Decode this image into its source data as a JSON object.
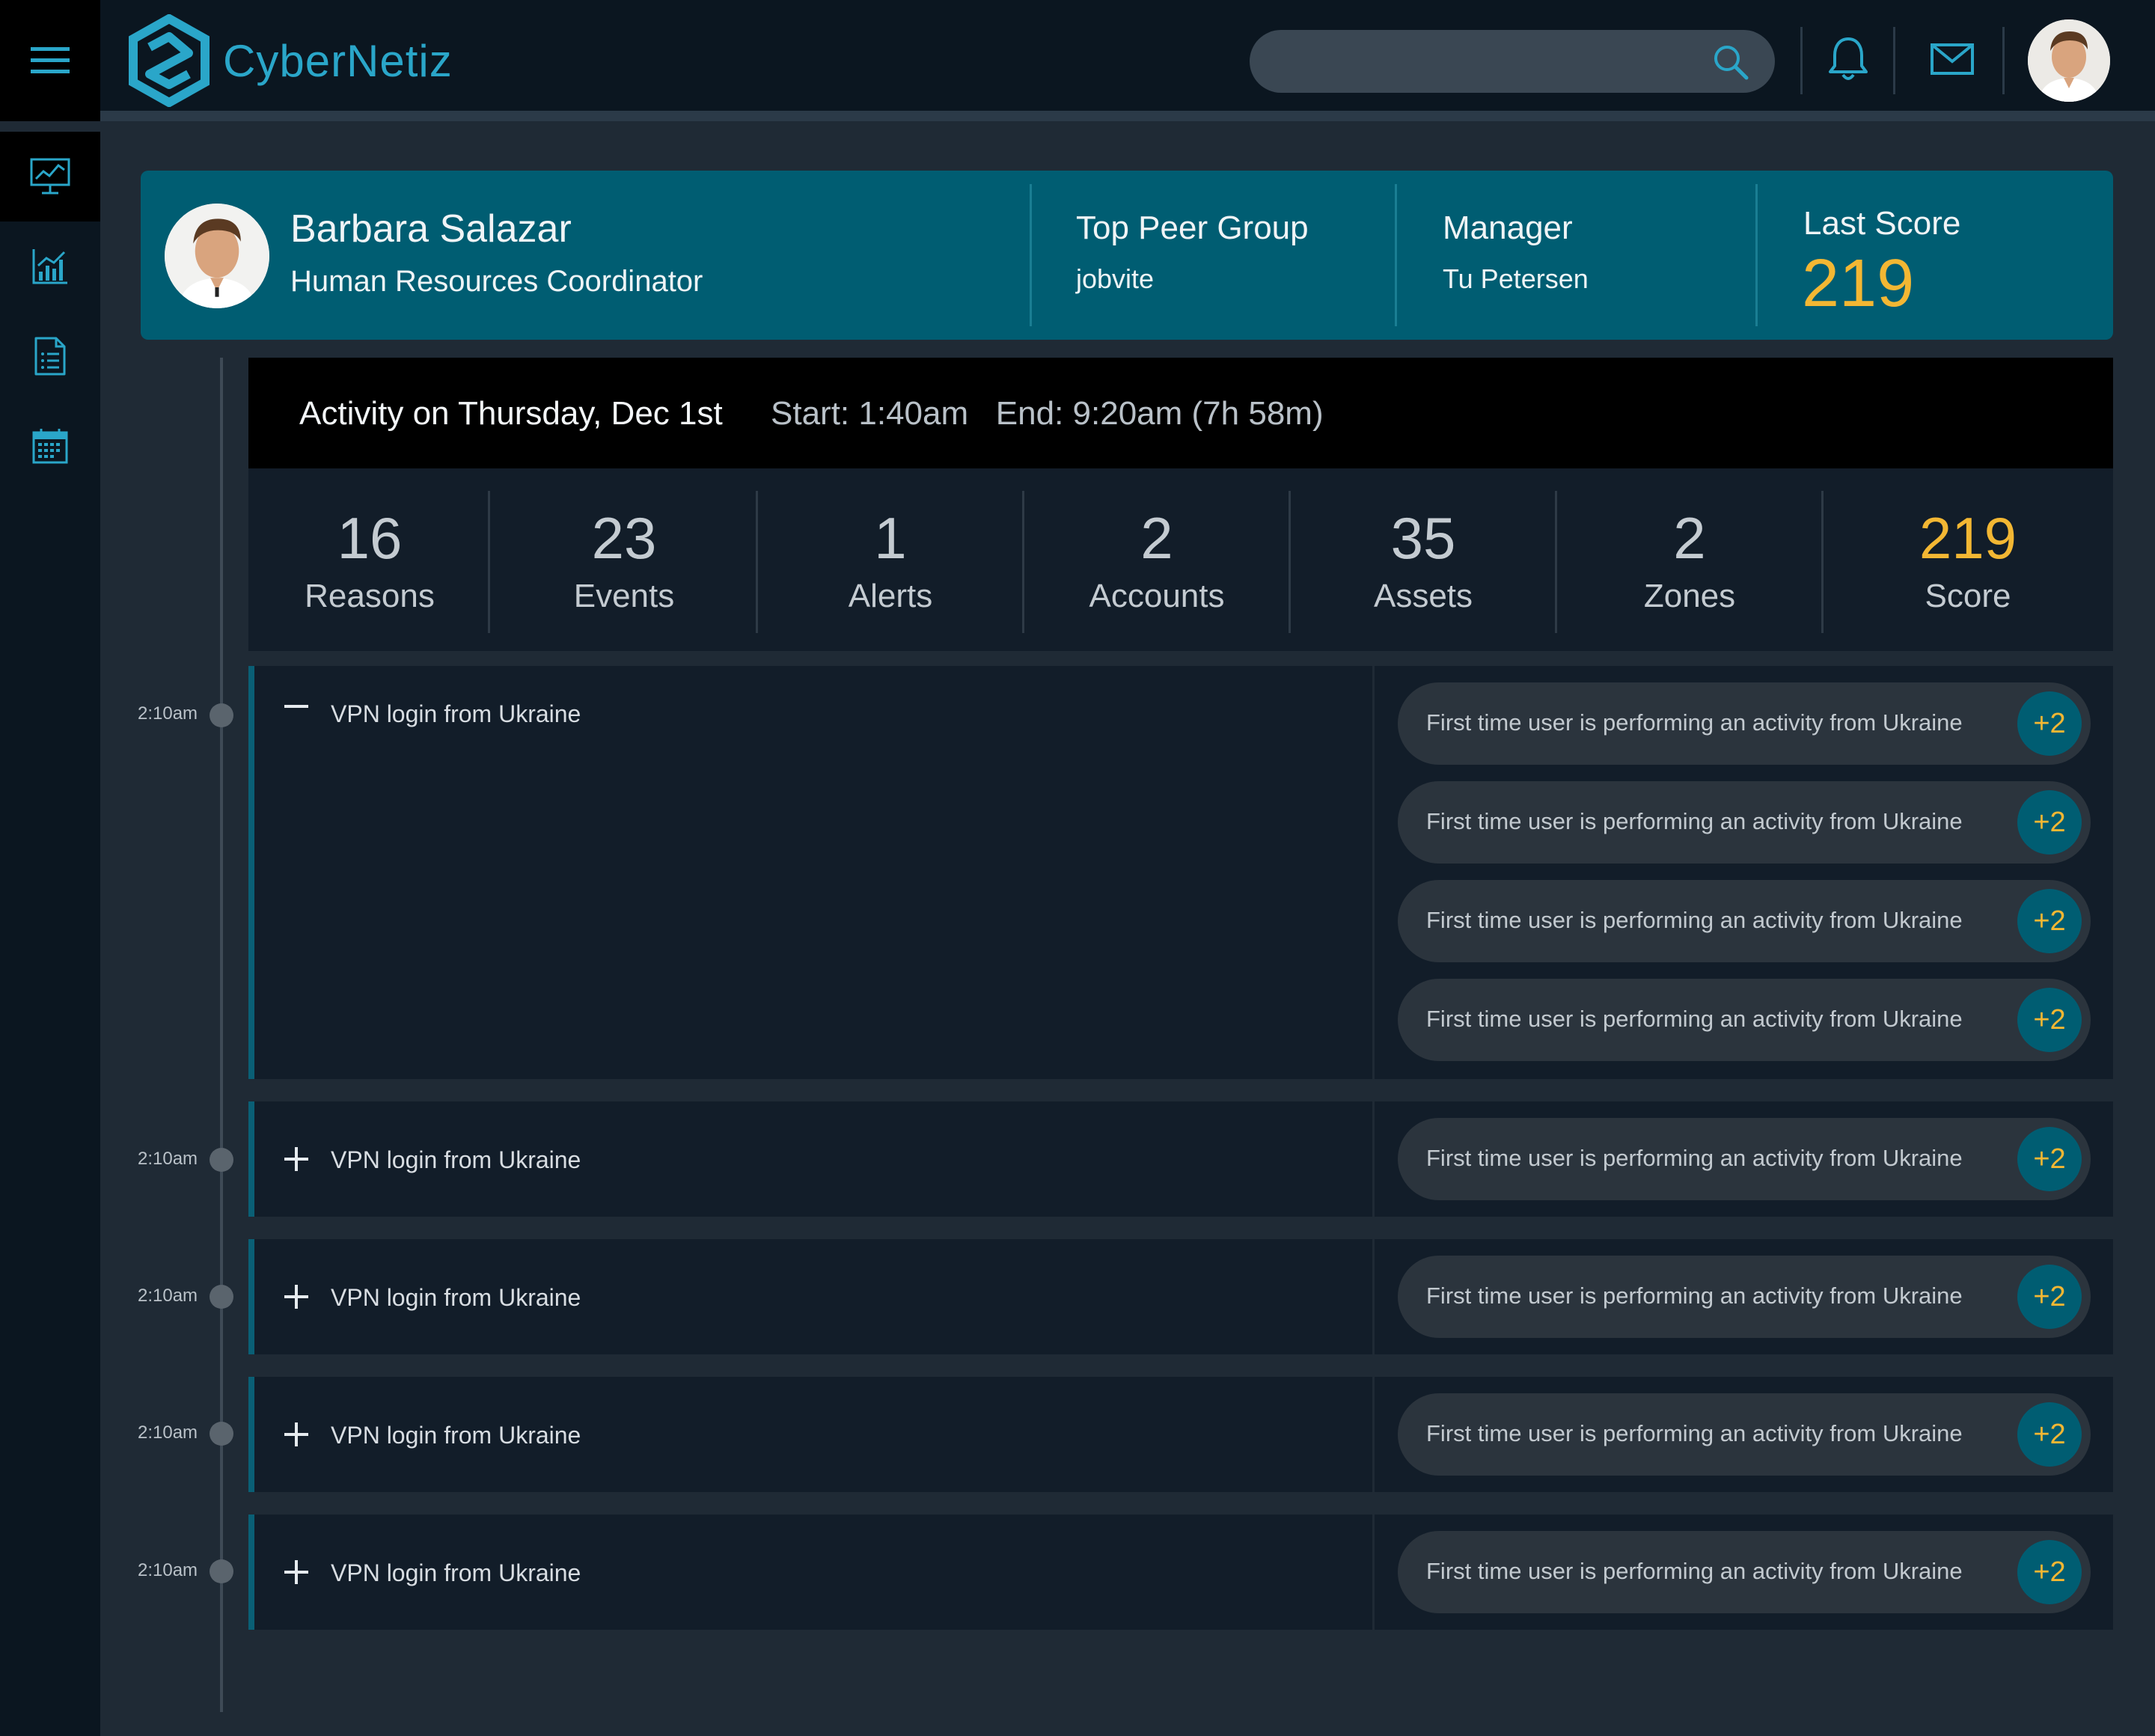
{
  "app": {
    "name": "CyberNetiz"
  },
  "search": {
    "placeholder": "",
    "value": ""
  },
  "sidebar": {
    "items": [
      {
        "icon": "monitor-chart-icon",
        "active": true
      },
      {
        "icon": "bar-chart-icon",
        "active": false
      },
      {
        "icon": "document-list-icon",
        "active": false
      },
      {
        "icon": "calendar-icon",
        "active": false
      }
    ]
  },
  "profile": {
    "name": "Barbara Salazar",
    "role": "Human Resources Coordinator",
    "peer_group_label": "Top Peer Group",
    "peer_group_value": "jobvite",
    "manager_label": "Manager",
    "manager_value": "Tu Petersen",
    "last_score_label": "Last Score",
    "last_score_value": "219"
  },
  "activity": {
    "title": "Activity on Thursday, Dec 1st",
    "time_range": "Start: 1:40am   End: 9:20am (7h 58m)"
  },
  "stats": [
    {
      "value": "16",
      "label": "Reasons"
    },
    {
      "value": "23",
      "label": "Events"
    },
    {
      "value": "1",
      "label": "Alerts"
    },
    {
      "value": "2",
      "label": "Accounts"
    },
    {
      "value": "35",
      "label": "Assets"
    },
    {
      "value": "2",
      "label": "Zones"
    },
    {
      "value": "219",
      "label": "Score"
    }
  ],
  "events": [
    {
      "time": "2:10am",
      "label": "VPN login from Ukraine",
      "expanded": true,
      "reasons": [
        {
          "text": "First time user is performing an activity from Ukraine",
          "badge": "+2"
        },
        {
          "text": "First time user is performing an activity from Ukraine",
          "badge": "+2"
        },
        {
          "text": "First time user is performing an activity from Ukraine",
          "badge": "+2"
        },
        {
          "text": "First time user is performing an activity from Ukraine",
          "badge": "+2"
        }
      ]
    },
    {
      "time": "2:10am",
      "label": "VPN login from Ukraine",
      "expanded": false,
      "reasons": [
        {
          "text": "First time user is performing an activity from Ukraine",
          "badge": "+2"
        }
      ]
    },
    {
      "time": "2:10am",
      "label": "VPN login from Ukraine",
      "expanded": false,
      "reasons": [
        {
          "text": "First time user is performing an activity from Ukraine",
          "badge": "+2"
        }
      ]
    },
    {
      "time": "2:10am",
      "label": "VPN login from Ukraine",
      "expanded": false,
      "reasons": [
        {
          "text": "First time user is performing an activity from Ukraine",
          "badge": "+2"
        }
      ]
    },
    {
      "time": "2:10am",
      "label": "VPN login from Ukraine",
      "expanded": false,
      "reasons": [
        {
          "text": "First time user is performing an activity from Ukraine",
          "badge": "+2"
        }
      ]
    }
  ],
  "colors": {
    "accent": "#2aa6c9",
    "banner": "#005d72",
    "score": "#f3b733",
    "background": "#1f2a35"
  }
}
